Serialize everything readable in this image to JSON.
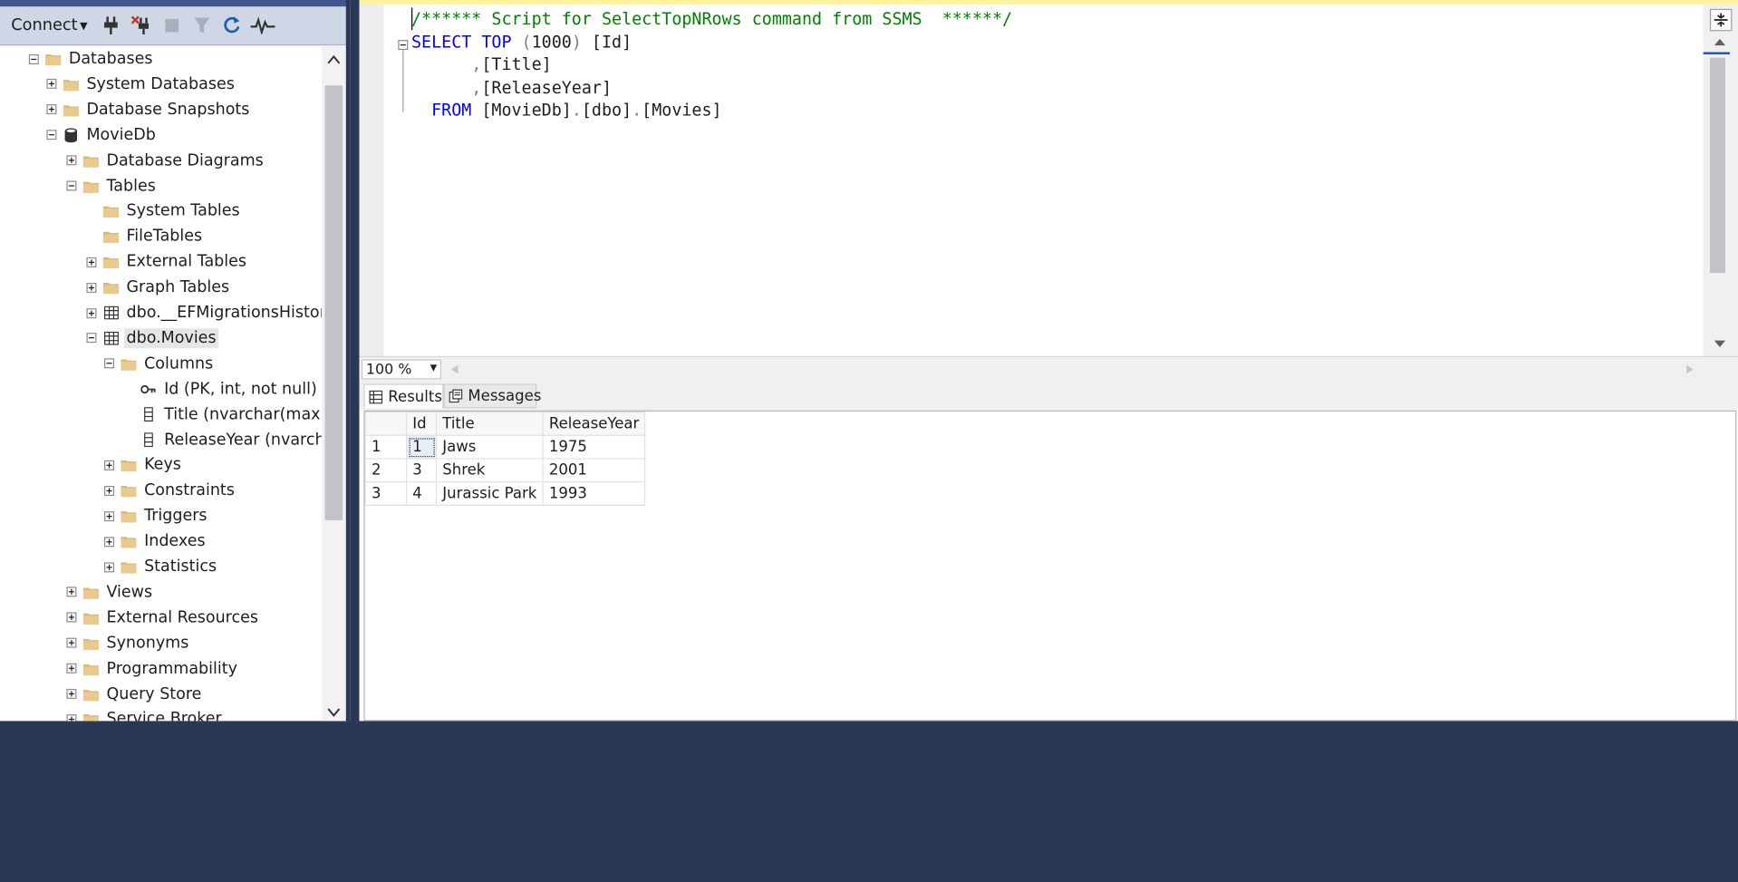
{
  "object_explorer": {
    "toolbar": {
      "connect_label": "Connect",
      "icons": [
        "connect-plug-icon",
        "disconnect-icon",
        "stop-icon",
        "filter-icon",
        "refresh-icon",
        "activity-monitor-icon"
      ]
    },
    "tree": [
      {
        "label": "Databases",
        "level": 0,
        "expander": "minus",
        "icon": "folder-icon"
      },
      {
        "label": "System Databases",
        "level": 1,
        "expander": "plus",
        "icon": "folder-icon"
      },
      {
        "label": "Database Snapshots",
        "level": 1,
        "expander": "plus",
        "icon": "folder-icon"
      },
      {
        "label": "MovieDb",
        "level": 1,
        "expander": "minus",
        "icon": "database-icon"
      },
      {
        "label": "Database Diagrams",
        "level": 2,
        "expander": "plus",
        "icon": "folder-icon"
      },
      {
        "label": "Tables",
        "level": 2,
        "expander": "minus",
        "icon": "folder-icon"
      },
      {
        "label": "System Tables",
        "level": 3,
        "expander": "none",
        "icon": "folder-icon"
      },
      {
        "label": "FileTables",
        "level": 3,
        "expander": "none",
        "icon": "folder-icon"
      },
      {
        "label": "External Tables",
        "level": 3,
        "expander": "plus",
        "icon": "folder-icon"
      },
      {
        "label": "Graph Tables",
        "level": 3,
        "expander": "plus",
        "icon": "folder-icon"
      },
      {
        "label": "dbo.__EFMigrationsHistory",
        "level": 3,
        "expander": "plus",
        "icon": "table-icon"
      },
      {
        "label": "dbo.Movies",
        "level": 3,
        "expander": "minus",
        "icon": "table-icon",
        "selected": true
      },
      {
        "label": "Columns",
        "level": 4,
        "expander": "minus",
        "icon": "folder-icon"
      },
      {
        "label": "Id (PK, int, not null)",
        "level": 5,
        "expander": "none",
        "icon": "key-icon"
      },
      {
        "label": "Title (nvarchar(max), not",
        "level": 5,
        "expander": "none",
        "icon": "column-icon"
      },
      {
        "label": "ReleaseYear (nvarchar(m",
        "level": 5,
        "expander": "none",
        "icon": "column-icon"
      },
      {
        "label": "Keys",
        "level": 4,
        "expander": "plus",
        "icon": "folder-icon"
      },
      {
        "label": "Constraints",
        "level": 4,
        "expander": "plus",
        "icon": "folder-icon"
      },
      {
        "label": "Triggers",
        "level": 4,
        "expander": "plus",
        "icon": "folder-icon"
      },
      {
        "label": "Indexes",
        "level": 4,
        "expander": "plus",
        "icon": "folder-icon"
      },
      {
        "label": "Statistics",
        "level": 4,
        "expander": "plus",
        "icon": "folder-icon"
      },
      {
        "label": "Views",
        "level": 2,
        "expander": "plus",
        "icon": "folder-icon"
      },
      {
        "label": "External Resources",
        "level": 2,
        "expander": "plus",
        "icon": "folder-icon"
      },
      {
        "label": "Synonyms",
        "level": 2,
        "expander": "plus",
        "icon": "folder-icon"
      },
      {
        "label": "Programmability",
        "level": 2,
        "expander": "plus",
        "icon": "folder-icon"
      },
      {
        "label": "Query Store",
        "level": 2,
        "expander": "plus",
        "icon": "folder-icon"
      },
      {
        "label": "Service Broker",
        "level": 2,
        "expander": "plus",
        "icon": "folder-icon"
      }
    ]
  },
  "editor": {
    "lines": [
      [
        {
          "t": "/****** Script for SelectTopNRows command from SSMS  ******/",
          "c": "c"
        }
      ],
      [
        {
          "t": "SELECT",
          "c": "k"
        },
        {
          "t": " ",
          "c": "t"
        },
        {
          "t": "TOP",
          "c": "k"
        },
        {
          "t": " ",
          "c": "t"
        },
        {
          "t": "(",
          "c": "g"
        },
        {
          "t": "1000",
          "c": "t"
        },
        {
          "t": ")",
          "c": "g"
        },
        {
          "t": " [Id]",
          "c": "t"
        }
      ],
      [
        {
          "t": "      ",
          "c": "t"
        },
        {
          "t": ",",
          "c": "g"
        },
        {
          "t": "[Title]",
          "c": "t"
        }
      ],
      [
        {
          "t": "      ",
          "c": "t"
        },
        {
          "t": ",",
          "c": "g"
        },
        {
          "t": "[ReleaseYear]",
          "c": "t"
        }
      ],
      [
        {
          "t": "  ",
          "c": "t"
        },
        {
          "t": "FROM",
          "c": "k"
        },
        {
          "t": " [MovieDb]",
          "c": "t"
        },
        {
          "t": ".",
          "c": "g"
        },
        {
          "t": "[dbo]",
          "c": "t"
        },
        {
          "t": ".",
          "c": "g"
        },
        {
          "t": "[Movies]",
          "c": "t"
        }
      ]
    ],
    "zoom": "100 %"
  },
  "results": {
    "tabs": {
      "results": "Results",
      "messages": "Messages"
    },
    "columns": [
      "Id",
      "Title",
      "ReleaseYear"
    ],
    "rows": [
      {
        "n": "1",
        "cells": [
          "1",
          "Jaws",
          "1975"
        ]
      },
      {
        "n": "2",
        "cells": [
          "3",
          "Shrek",
          "2001"
        ]
      },
      {
        "n": "3",
        "cells": [
          "4",
          "Jurassic Park",
          "1993"
        ]
      }
    ]
  }
}
